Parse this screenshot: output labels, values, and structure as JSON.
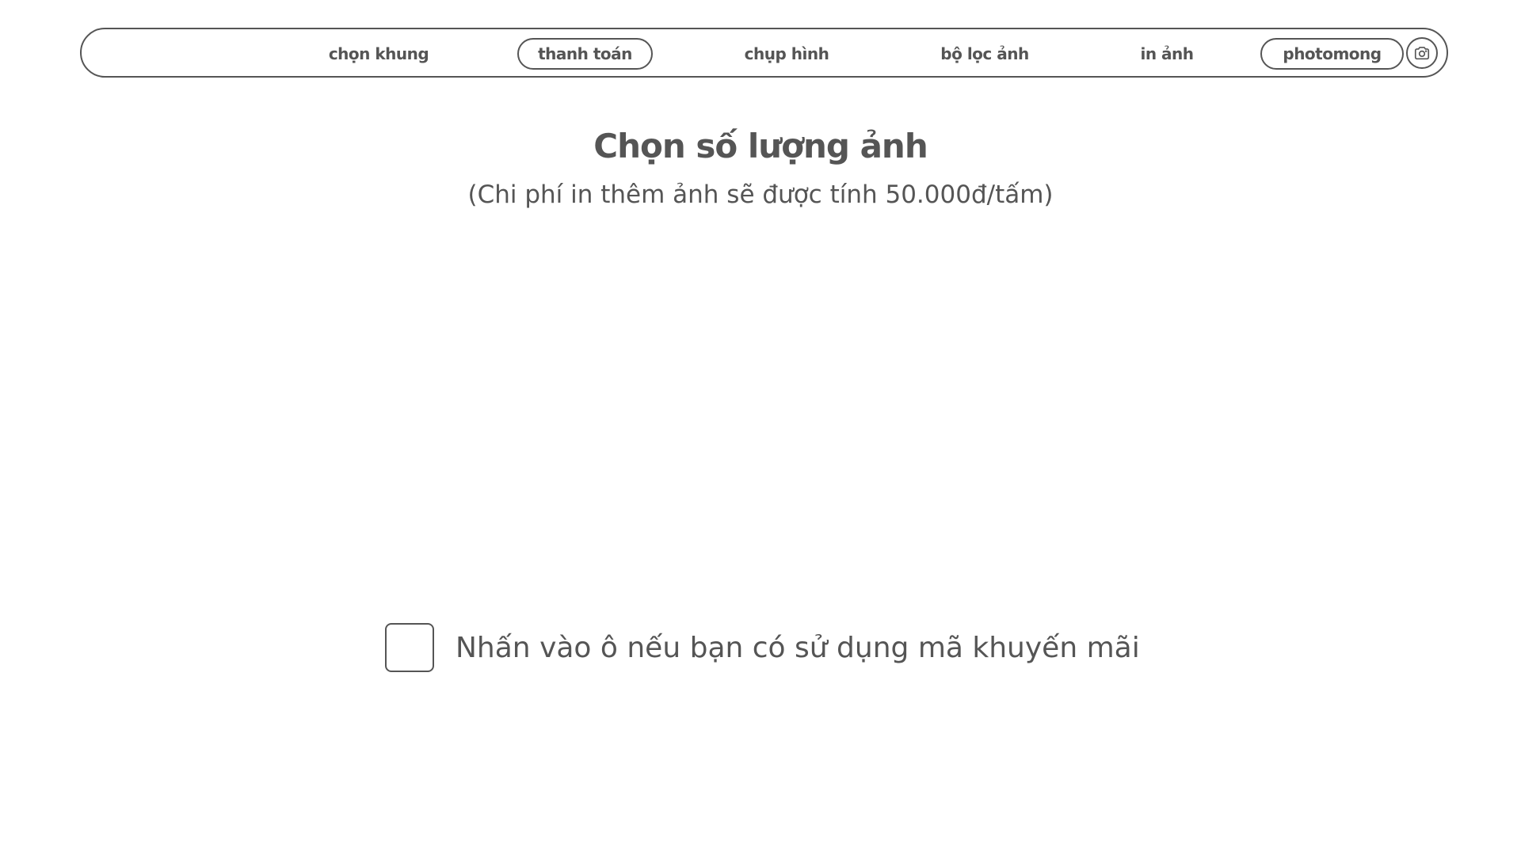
{
  "nav": {
    "items": [
      {
        "label": "chọn khung",
        "boxed": false
      },
      {
        "label": "thanh toán",
        "boxed": true
      },
      {
        "label": "chụp hình",
        "boxed": false
      },
      {
        "label": "bộ lọc ảnh",
        "boxed": false
      },
      {
        "label": "in ảnh",
        "boxed": false
      },
      {
        "label": "photomong",
        "boxed": true
      }
    ],
    "camera_icon": "camera-icon"
  },
  "main": {
    "title": "Chọn số lượng ảnh",
    "subtitle": "(Chi phí in thêm ảnh sẽ được tính 50.000đ/tấm)"
  },
  "promo": {
    "checked": false,
    "label": "Nhấn vào ô nếu bạn có sử dụng mã khuyến mãi"
  },
  "colors": {
    "text": "#555555",
    "background": "#ffffff"
  }
}
